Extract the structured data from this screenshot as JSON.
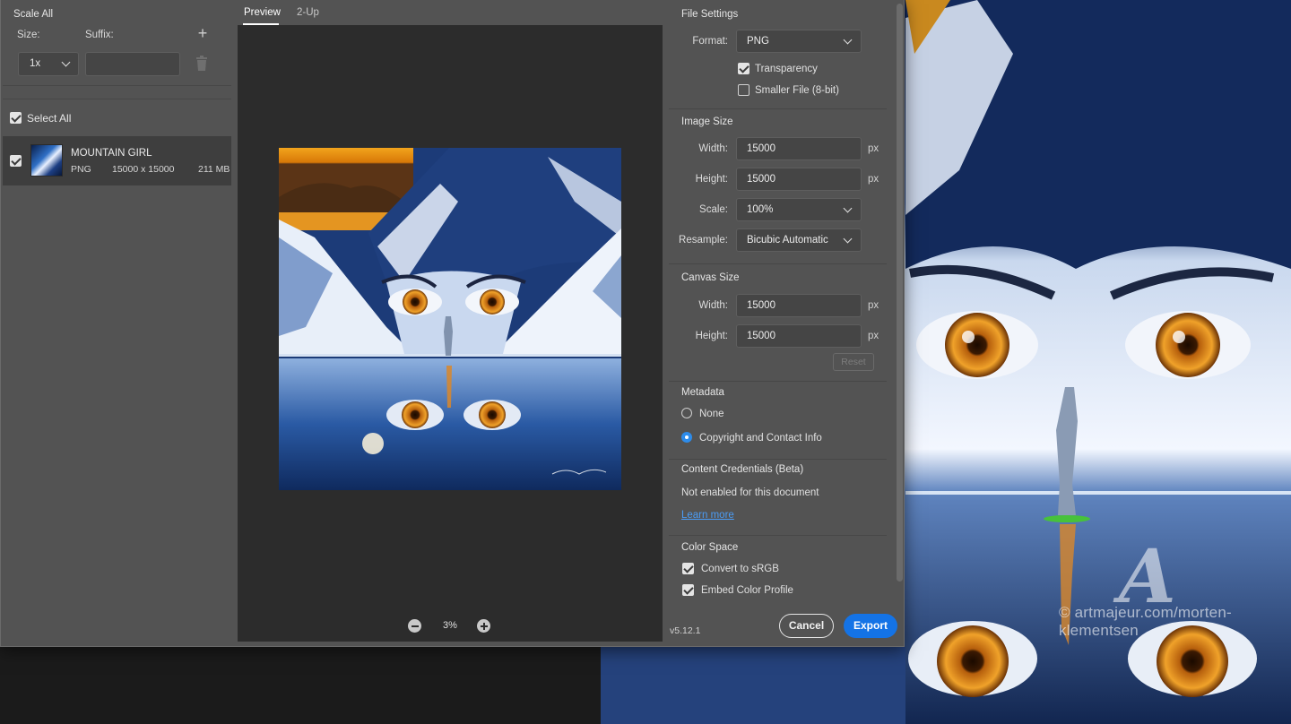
{
  "scale_all": {
    "title": "Scale All",
    "size_label": "Size:",
    "suffix_label": "Suffix:",
    "size_value": "1x",
    "suffix_value": ""
  },
  "assets": {
    "select_all_label": "Select All",
    "select_all_checked": true,
    "items": [
      {
        "name": "MOUNTAIN GIRL",
        "format": "PNG",
        "dimensions": "15000 x 15000",
        "file_size": "211 MB",
        "checked": true
      }
    ]
  },
  "preview": {
    "tabs": [
      {
        "label": "Preview",
        "active": true
      },
      {
        "label": "2-Up",
        "active": false
      }
    ],
    "zoom_level": "3%"
  },
  "file_settings": {
    "title": "File Settings",
    "format_label": "Format:",
    "format_value": "PNG",
    "transparency_label": "Transparency",
    "transparency_checked": true,
    "smaller_file_label": "Smaller File (8-bit)",
    "smaller_file_checked": false
  },
  "image_size": {
    "title": "Image Size",
    "width_label": "Width:",
    "width_value": "15000",
    "height_label": "Height:",
    "height_value": "15000",
    "unit": "px",
    "scale_label": "Scale:",
    "scale_value": "100%",
    "resample_label": "Resample:",
    "resample_value": "Bicubic Automatic"
  },
  "canvas_size": {
    "title": "Canvas Size",
    "width_label": "Width:",
    "width_value": "15000",
    "height_label": "Height:",
    "height_value": "15000",
    "unit": "px",
    "reset_label": "Reset"
  },
  "metadata": {
    "title": "Metadata",
    "options": [
      {
        "label": "None",
        "selected": false
      },
      {
        "label": "Copyright and Contact Info",
        "selected": true
      }
    ]
  },
  "content_credentials": {
    "title": "Content Credentials (Beta)",
    "status": "Not enabled for this document",
    "link": "Learn more"
  },
  "color_space": {
    "title": "Color Space",
    "convert_label": "Convert to sRGB",
    "convert_checked": true,
    "embed_label": "Embed Color Profile",
    "embed_checked": true
  },
  "footer": {
    "version": "v5.12.1",
    "cancel_label": "Cancel",
    "export_label": "Export"
  },
  "watermark": {
    "glyph": "A",
    "text": "© artmajeur.com/morten-klementsen"
  },
  "colors": {
    "accent": "#1473e6",
    "radio_selected": "#2d8ceb",
    "link": "#4b9cf5",
    "dialog_bg": "#535353",
    "preview_bg": "#2c2c2c"
  }
}
